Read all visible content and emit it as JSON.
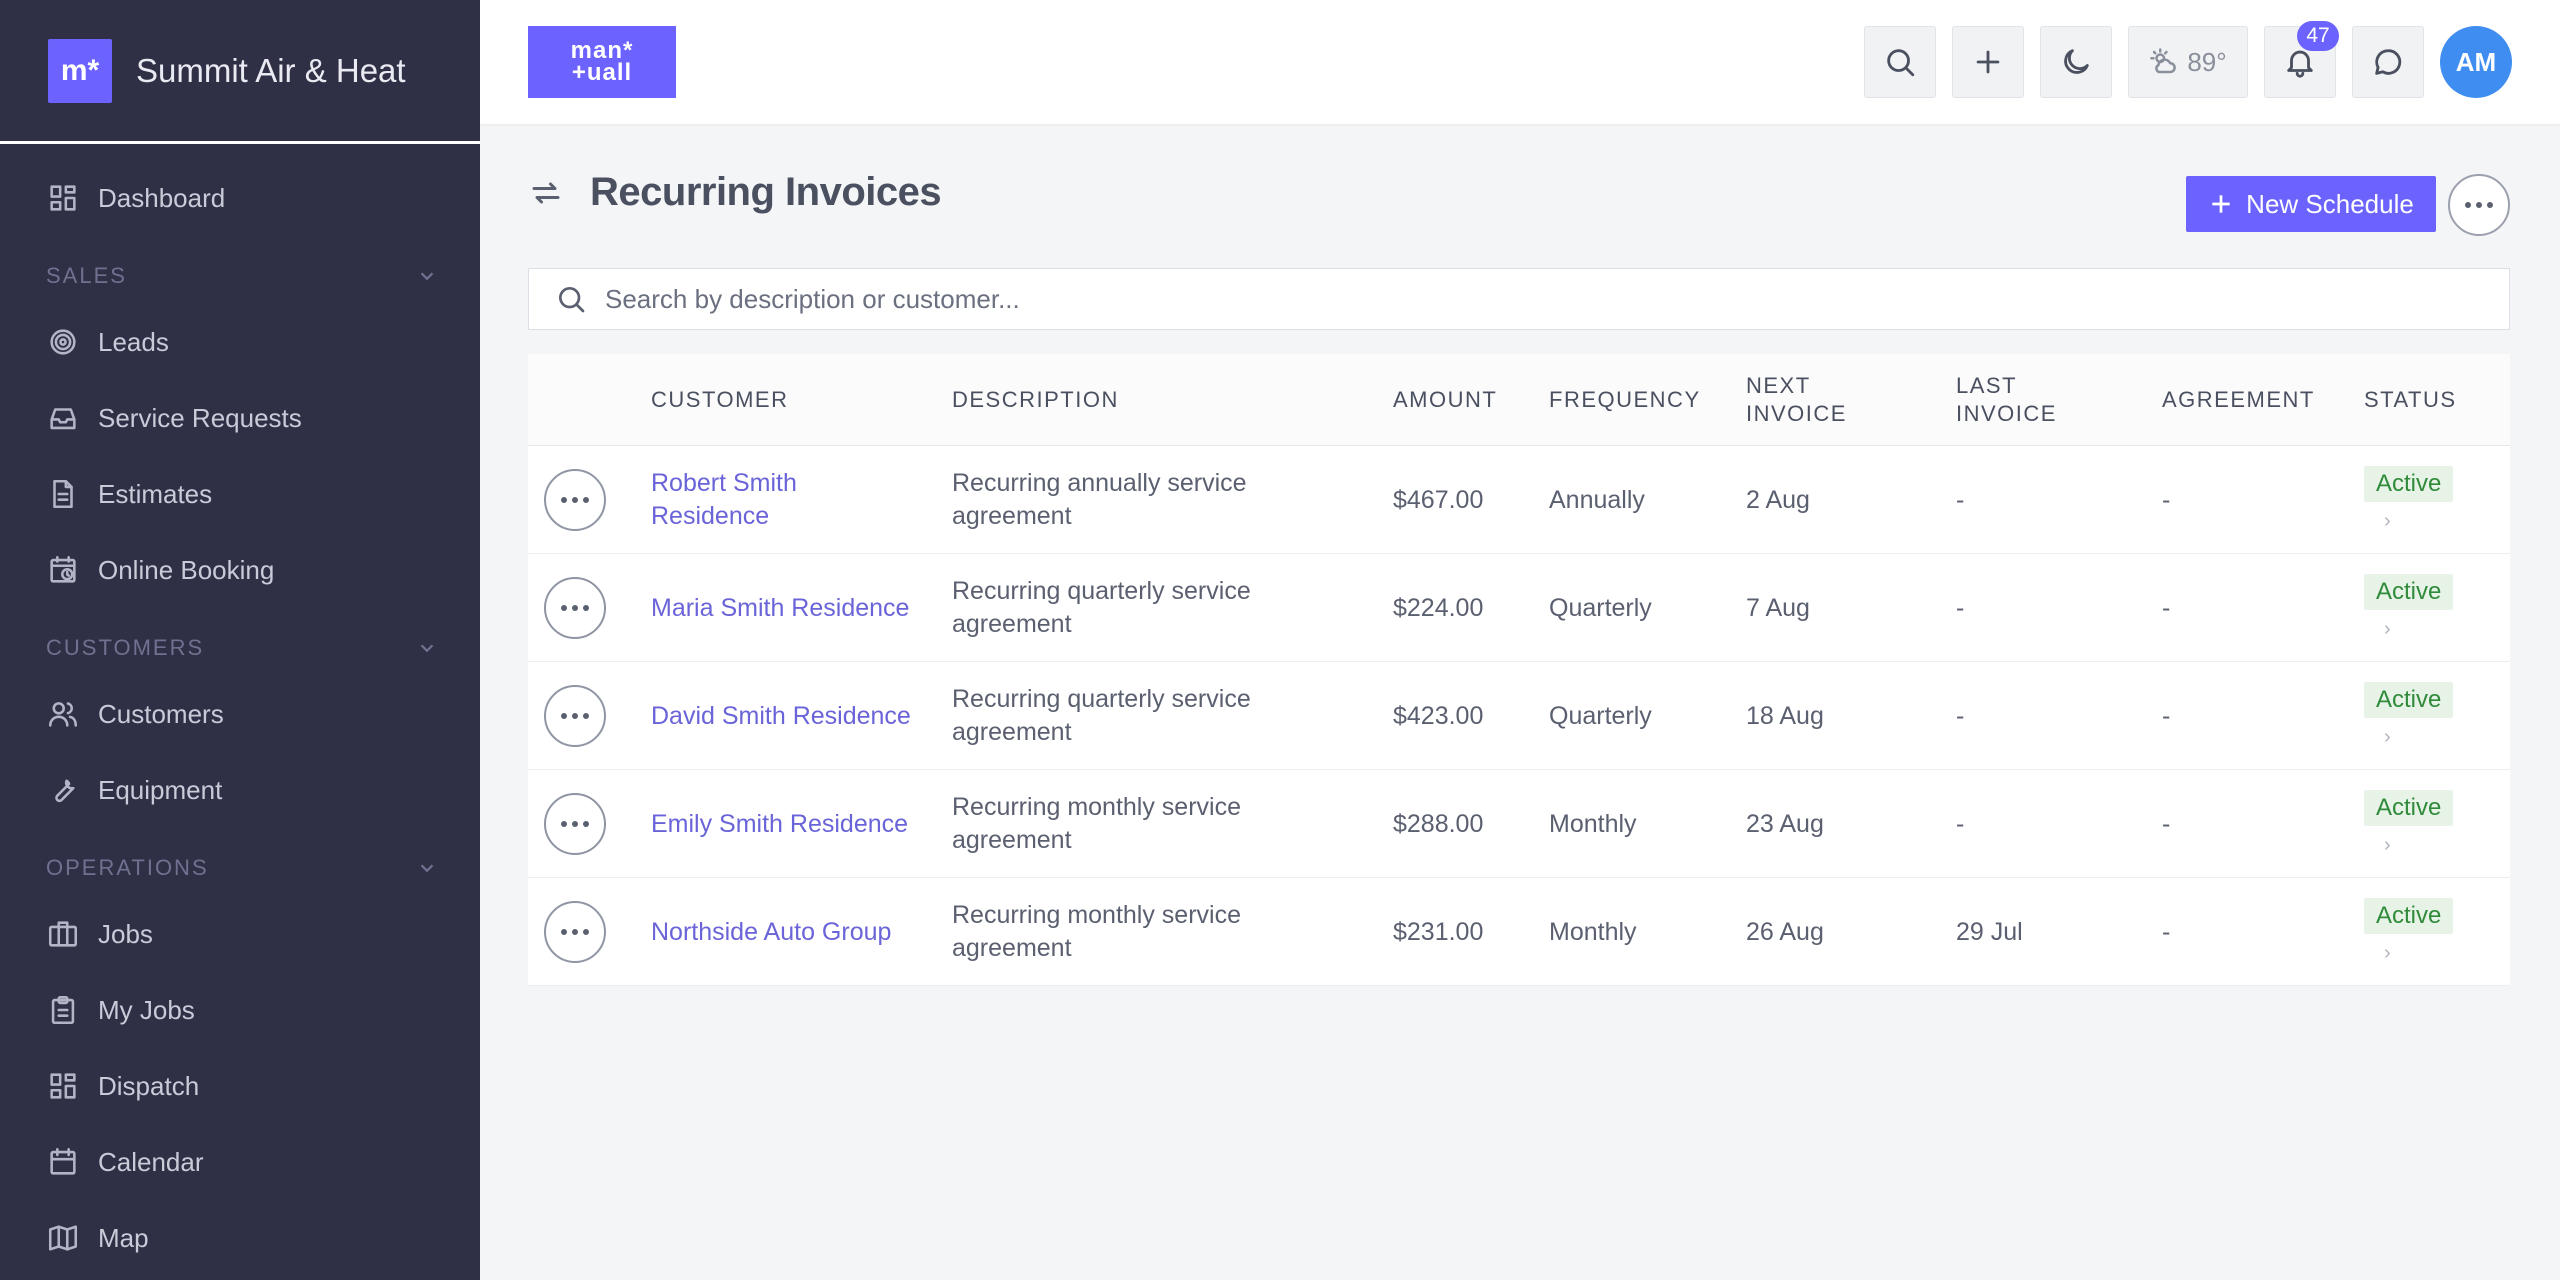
{
  "brand": {
    "logo_text": "m*",
    "name": "Summit Air & Heat"
  },
  "sidebar": {
    "items": [
      {
        "type": "item",
        "label": "Dashboard",
        "icon": "grid-icon"
      },
      {
        "type": "section",
        "label": "SALES"
      },
      {
        "type": "item",
        "label": "Leads",
        "icon": "target-icon"
      },
      {
        "type": "item",
        "label": "Service Requests",
        "icon": "inbox-icon"
      },
      {
        "type": "item",
        "label": "Estimates",
        "icon": "document-icon"
      },
      {
        "type": "item",
        "label": "Online Booking",
        "icon": "calendar-clock-icon"
      },
      {
        "type": "section",
        "label": "CUSTOMERS"
      },
      {
        "type": "item",
        "label": "Customers",
        "icon": "users-icon"
      },
      {
        "type": "item",
        "label": "Equipment",
        "icon": "wrench-icon"
      },
      {
        "type": "section",
        "label": "OPERATIONS"
      },
      {
        "type": "item",
        "label": "Jobs",
        "icon": "briefcase-icon"
      },
      {
        "type": "item",
        "label": "My Jobs",
        "icon": "clipboard-icon"
      },
      {
        "type": "item",
        "label": "Dispatch",
        "icon": "grid-icon"
      },
      {
        "type": "item",
        "label": "Calendar",
        "icon": "calendar-icon"
      },
      {
        "type": "item",
        "label": "Map",
        "icon": "map-icon"
      }
    ]
  },
  "topbar": {
    "logo_line1": "man*",
    "logo_line2": "+uall",
    "weather": "89°",
    "notifications_count": "47",
    "avatar_initials": "AM"
  },
  "page": {
    "title": "Recurring Invoices",
    "new_button": "New Schedule",
    "search_placeholder": "Search by description or customer..."
  },
  "table": {
    "headers": {
      "customer": "CUSTOMER",
      "description": "DESCRIPTION",
      "amount": "AMOUNT",
      "frequency": "FREQUENCY",
      "next_invoice": "NEXT INVOICE",
      "last_invoice": "LAST INVOICE",
      "agreement": "AGREEMENT",
      "status": "STATUS"
    },
    "rows": [
      {
        "customer": "Robert Smith Residence",
        "description": "Recurring annually service agreement",
        "amount": "$467.00",
        "frequency": "Annually",
        "next_invoice": "2 Aug",
        "last_invoice": "-",
        "agreement": "-",
        "status": "Active"
      },
      {
        "customer": "Maria Smith Residence",
        "description": "Recurring quarterly service agreement",
        "amount": "$224.00",
        "frequency": "Quarterly",
        "next_invoice": "7 Aug",
        "last_invoice": "-",
        "agreement": "-",
        "status": "Active"
      },
      {
        "customer": "David Smith Residence",
        "description": "Recurring quarterly service agreement",
        "amount": "$423.00",
        "frequency": "Quarterly",
        "next_invoice": "18 Aug",
        "last_invoice": "-",
        "agreement": "-",
        "status": "Active"
      },
      {
        "customer": "Emily Smith Residence",
        "description": "Recurring monthly service agreement",
        "amount": "$288.00",
        "frequency": "Monthly",
        "next_invoice": "23 Aug",
        "last_invoice": "-",
        "agreement": "-",
        "status": "Active"
      },
      {
        "customer": "Northside Auto Group",
        "description": "Recurring monthly service agreement",
        "amount": "$231.00",
        "frequency": "Monthly",
        "next_invoice": "26 Aug",
        "last_invoice": "29 Jul",
        "agreement": "-",
        "status": "Active"
      }
    ]
  },
  "colors": {
    "accent": "#6c63ff",
    "sidebar_bg": "#2f3045",
    "status_active": "#2f8a3a",
    "avatar": "#3f8df0"
  }
}
